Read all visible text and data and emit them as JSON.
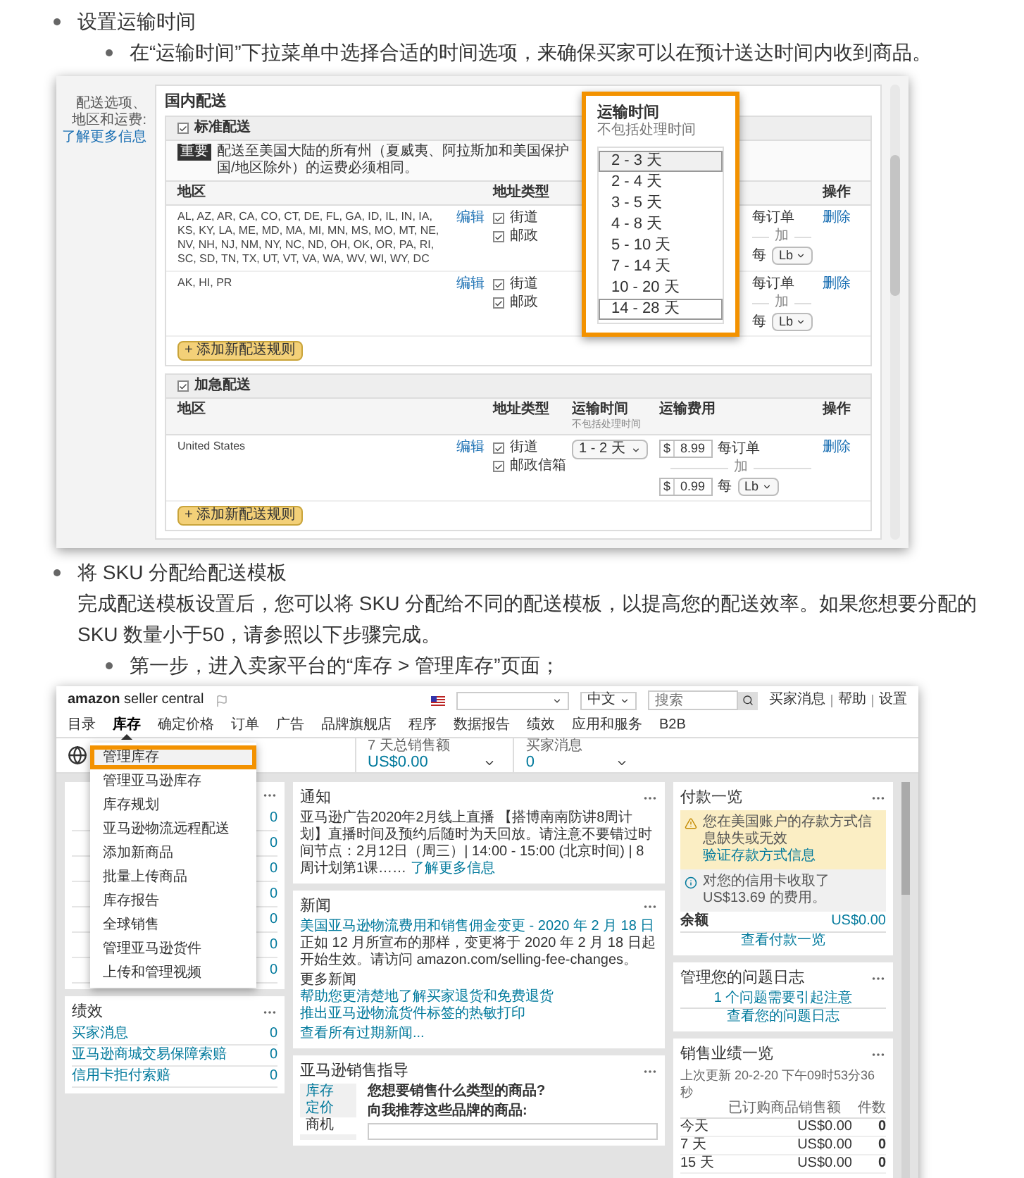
{
  "step_1": {
    "title": "设置运输时间",
    "detail": "在“运输时间”下拉菜单中选择合适的时间选项，来确保买家可以在预计送达时间内收到商品。"
  },
  "shipping_screenshot": {
    "side_label": "配送选项、地区和运费:",
    "side_link": "了解更多信息",
    "heading": "国内配送",
    "groups": [
      {
        "title": "标准配送",
        "checked": true,
        "note_tag": "重要",
        "note": "配送至美国大陆的所有州（夏威夷、阿拉斯加和美国保护国/地区除外）的运费必须相同。",
        "columns": {
          "region": "地区",
          "address": "地址类型",
          "action": "操作"
        },
        "rows": [
          {
            "region": "AL, AZ, AR, CA, CO, CT, DE, FL, GA, ID, IL, IN, IA, KS, KY, LA, ME, MD, MA, MI, MN, MS, MO, MT, NE, NV, NH, NJ, NM, NY, NC, ND, OH, OK, OR, PA, RI, SC, SD, TN, TX, UT, VT, VA, WA, WV, WI, WY, DC",
            "edit": "编辑",
            "address_types": [
              {
                "label": "街道",
                "checked": true
              },
              {
                "label": "邮政",
                "checked": true
              }
            ],
            "fee": {
              "per_order": "每订单",
              "plus": "加",
              "per": "每",
              "unit": "Lb"
            },
            "action": "删除"
          },
          {
            "region": "AK, HI, PR",
            "edit": "编辑",
            "address_types": [
              {
                "label": "街道",
                "checked": true
              },
              {
                "label": "邮政",
                "checked": true
              }
            ],
            "fee": {
              "per_order": "每订单",
              "plus": "加",
              "per": "每",
              "unit": "Lb"
            },
            "action": "删除"
          }
        ],
        "add_button": "+ 添加新配送规则"
      },
      {
        "title": "加急配送",
        "checked": true,
        "columns": {
          "region": "地区",
          "address": "地址类型",
          "time": "运输时间",
          "time_note": "不包括处理时间",
          "fee": "运输费用",
          "action": "操作"
        },
        "rows": [
          {
            "region": "United States",
            "edit": "编辑",
            "address_types": [
              {
                "label": "街道",
                "checked": true
              },
              {
                "label": "邮政信箱",
                "checked": true
              }
            ],
            "time": "1 - 2 天",
            "fee": {
              "currency": "$",
              "amount": "8.99",
              "per_order": "每订单",
              "plus": "加",
              "currency_2": "$",
              "amount_2": "0.99",
              "per": "每",
              "unit": "Lb"
            },
            "action": "删除"
          }
        ],
        "add_button": "+ 添加新配送规则"
      }
    ],
    "time_popup": {
      "title": "运输时间",
      "subtitle": "不包括处理时间",
      "options": [
        {
          "label": "2 - 3 天",
          "selected": true,
          "highlighted": true
        },
        {
          "label": "2 - 4 天",
          "selected": false,
          "highlighted": false
        },
        {
          "label": "3 - 5 天",
          "selected": false,
          "highlighted": false
        },
        {
          "label": "4 - 8 天",
          "selected": false,
          "highlighted": false
        },
        {
          "label": "5 - 10 天",
          "selected": false,
          "highlighted": false
        },
        {
          "label": "7 - 14 天",
          "selected": false,
          "highlighted": false
        },
        {
          "label": "10 - 20 天",
          "selected": false,
          "highlighted": false
        },
        {
          "label": "14 - 28 天",
          "selected": false,
          "highlighted": true
        }
      ]
    }
  },
  "step_2": {
    "title": "将 SKU 分配给配送模板",
    "paragraph": "完成配送模板设置后，您可以将 SKU 分配给不同的配送模板，以提高您的配送效率。如果您想要分配的 SKU 数量小于50，请参照以下步骤完成。",
    "sub_step": "第一步，进入卖家平台的“库存 > 管理库存”页面；"
  },
  "seller_central_screenshot": {
    "logo": "**amazon** seller central",
    "language": "中文",
    "search_placeholder": "搜索",
    "header_links": [
      "买家消息",
      "帮助",
      "设置"
    ],
    "nav": [
      {
        "label": "目录",
        "selected": false
      },
      {
        "label": "库存",
        "selected": true
      },
      {
        "label": "确定价格",
        "selected": false
      },
      {
        "label": "订单",
        "selected": false
      },
      {
        "label": "广告",
        "selected": false
      },
      {
        "label": "品牌旗舰店",
        "selected": false
      },
      {
        "label": "程序",
        "selected": false
      },
      {
        "label": "数据报告",
        "selected": false
      },
      {
        "label": "绩效",
        "selected": false
      },
      {
        "label": "应用和服务",
        "selected": false
      },
      {
        "label": "B2B",
        "selected": false
      }
    ],
    "metrics": [
      {
        "label": "7 天总销售额",
        "value": "US$0.00"
      },
      {
        "label": "买家消息",
        "value": "0"
      }
    ],
    "inventory_menu": [
      {
        "label": "管理库存",
        "selected": true
      },
      {
        "label": "管理亚马逊库存",
        "selected": false
      },
      {
        "label": "库存规划",
        "selected": false
      },
      {
        "label": "亚马逊物流远程配送",
        "selected": false
      },
      {
        "label": "添加新商品",
        "selected": false
      },
      {
        "label": "批量上传商品",
        "selected": false
      },
      {
        "label": "库存报告",
        "selected": false
      },
      {
        "label": "全球销售",
        "selected": false
      },
      {
        "label": "管理亚马逊货件",
        "selected": false
      },
      {
        "label": "上传和管理视频",
        "selected": false
      }
    ],
    "left_card_counts": [
      "0",
      "0",
      "0",
      "0",
      "0",
      "0",
      "0"
    ],
    "performance": {
      "title": "绩效",
      "rows": [
        {
          "label": "买家消息",
          "count": "0"
        },
        {
          "label": "亚马逊商城交易保障索赔",
          "count": "0"
        },
        {
          "label": "信用卡拒付索赔",
          "count": "0"
        }
      ]
    },
    "notice": {
      "title": "通知",
      "headline": "亚马逊广告2020年2月线上直播",
      "text": "【搭博南南防讲8周计划】直播时间及预约后随时为天回放。请注意不要错过时间节点：2月12日（周三）| 14:00 - 15:00 (北京时间) | 8周计划第1课……",
      "link": "了解更多信息"
    },
    "news": {
      "title": "新闻",
      "headline": "美国亚马逊物流费用和销售佣金变更 - 2020 年 2 月 18 日",
      "text": "正如 12 月所宣布的那样，变更将于 2020 年 2 月 18 日起开始生效。请访问 amazon.com/selling-fee-changes。",
      "more_title": "更多新闻",
      "more_links": [
        "帮助您更清楚地了解买家退货和免费退货",
        "推出亚马逊物流货件标签的热敏打印"
      ],
      "all_link": "查看所有过期新闻..."
    },
    "guide": {
      "title": "亚马逊销售指导",
      "tabs": [
        {
          "label": "库存",
          "selected": false
        },
        {
          "label": "定价",
          "selected": false
        },
        {
          "label": "商机",
          "selected": true
        }
      ],
      "question": "您想要销售什么类型的商品?",
      "brand_label": "向我推荐这些品牌的商品:"
    },
    "payments": {
      "title": "付款一览",
      "warning": "您在美国账户的存款方式信息缺失或无效",
      "warning_link": "验证存款方式信息",
      "info": "对您的信用卡收取了 US$13.69 的费用。",
      "balance_label": "余额",
      "balance": "US$0.00",
      "link": "查看付款一览"
    },
    "issues": {
      "title": "管理您的问题日志",
      "alert_link": "1 个问题需要引起注意",
      "link": "查看您的问题日志"
    },
    "sales": {
      "title": "销售业绩一览",
      "updated": "上次更新 20-2-20 下午09时53分36秒",
      "columns": [
        "已订购商品销售额",
        "件数"
      ],
      "rows": [
        {
          "period": "今天",
          "amount": "US$0.00",
          "units": "0"
        },
        {
          "period": "7 天",
          "amount": "US$0.00",
          "units": "0"
        },
        {
          "period": "15 天",
          "amount": "US$0.00",
          "units": "0"
        }
      ]
    }
  }
}
